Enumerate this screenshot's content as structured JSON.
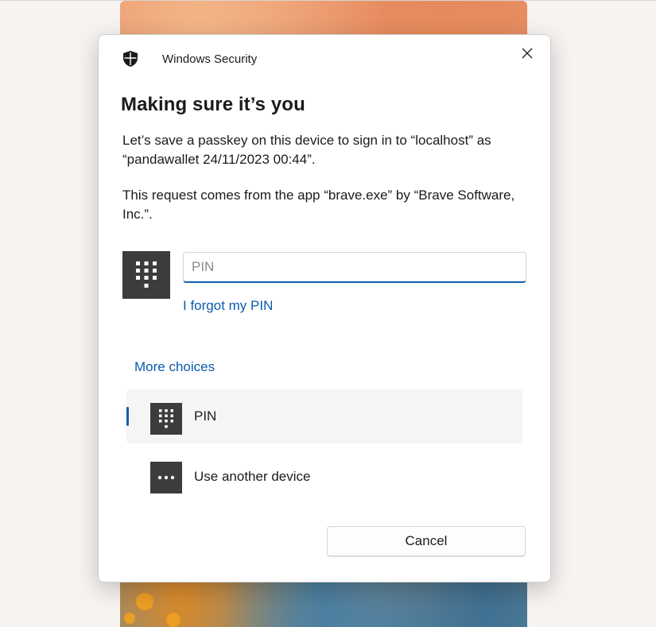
{
  "window": {
    "app_title": "Windows Security"
  },
  "dialog": {
    "heading": "Making sure it’s you",
    "message_1": "Let’s save a passkey on this device to sign in to “localhost” as “pandawallet 24/11/2023 00:44”.",
    "message_2": "This request comes from the app “brave.exe” by “Brave Software, Inc.”."
  },
  "pin": {
    "placeholder": "PIN",
    "value": "",
    "forgot_link": "I forgot my PIN"
  },
  "choices": {
    "header": "More choices",
    "items": [
      {
        "label": "PIN",
        "icon": "keypad-icon",
        "selected": true
      },
      {
        "label": "Use another device",
        "icon": "more-dots-icon",
        "selected": false
      }
    ]
  },
  "buttons": {
    "cancel": "Cancel"
  },
  "colors": {
    "accent": "#0f5fb0",
    "link": "#0b5cad",
    "icon_tile": "#3c3c3c"
  }
}
